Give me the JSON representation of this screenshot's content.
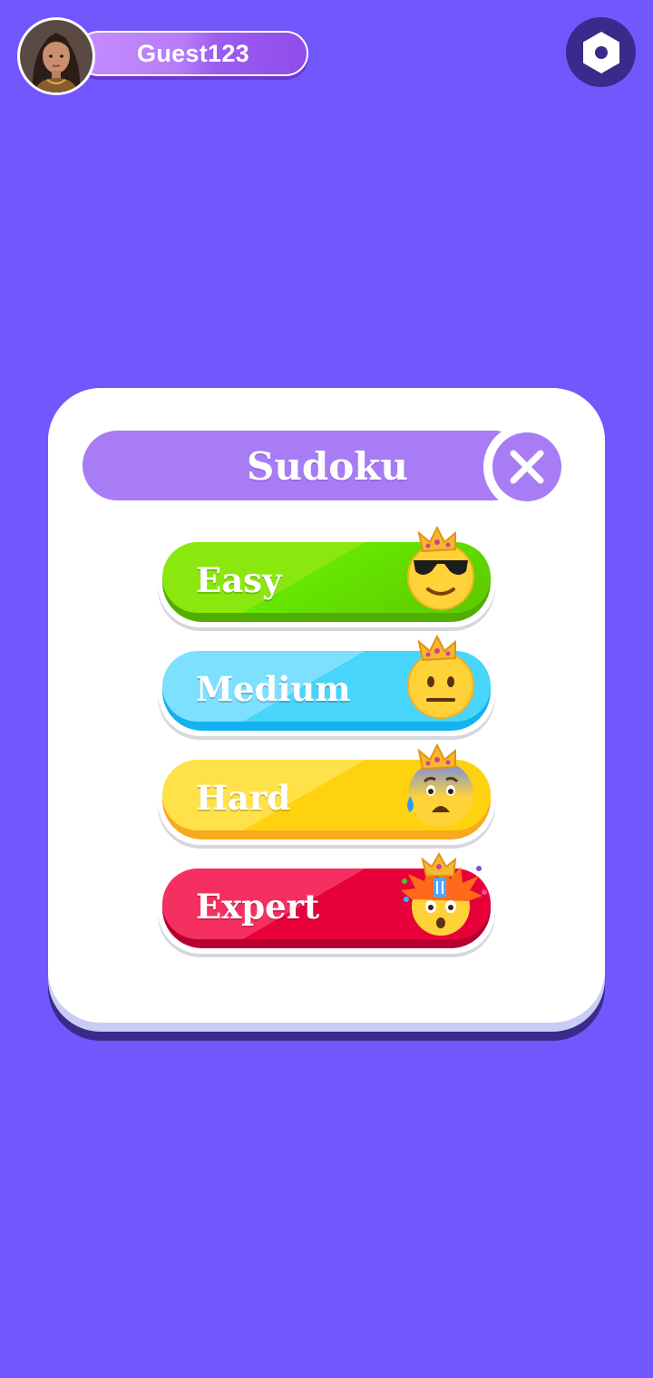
{
  "header": {
    "username": "Guest123",
    "avatar_icon": "avatar-portrait",
    "settings_icon": "hexagon-settings-icon"
  },
  "modal": {
    "title": "Sudoku",
    "close_icon": "close-icon",
    "difficulties": [
      {
        "label": "Easy",
        "icon": "cool-crown-emoji",
        "color_light": "#8ae80f",
        "color_dark": "#5ec700",
        "color_base": "#4fae00"
      },
      {
        "label": "Medium",
        "icon": "neutral-crown-emoji",
        "color_light": "#7ee0ff",
        "color_dark": "#49d4fb",
        "color_base": "#14b2ef"
      },
      {
        "label": "Hard",
        "icon": "anxious-crown-emoji",
        "color_light": "#ffe24a",
        "color_dark": "#ffd20f",
        "color_base": "#f7a91f"
      },
      {
        "label": "Expert",
        "icon": "exploding-head-crown-emoji",
        "color_light": "#f53060",
        "color_dark": "#e8003a",
        "color_base": "#b80030"
      }
    ]
  },
  "colors": {
    "background": "#7257fc",
    "accent_purple": "#a77cf5",
    "settings_bg": "#3a2a8c"
  }
}
